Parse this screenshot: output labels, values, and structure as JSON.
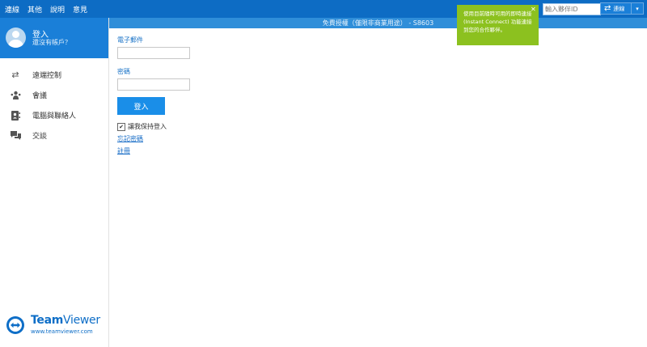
{
  "menu": [
    "連線",
    "其他",
    "說明",
    "意見"
  ],
  "partner": {
    "placeholder": "輸入夥伴ID",
    "connect_label": "連線"
  },
  "license_text": "免費授權（僅限非商業用途） - S8603",
  "account": {
    "title": "登入",
    "subtitle": "還沒有帳戶？"
  },
  "nav": [
    "遠端控制",
    "會議",
    "電腦與聯絡人",
    "交談"
  ],
  "form": {
    "email_label": "電子郵件",
    "password_label": "密碼",
    "login_label": "登入",
    "keep_label": "讓我保持登入",
    "forgot_label": "忘記密碼",
    "register_label": "註冊"
  },
  "tooltip": {
    "text": "使用目前隨時可用的即時連接 (Instant Connect) 功能連接到您的合作夥伴。"
  },
  "logo": {
    "name_bold": "Team",
    "name_light": "Viewer",
    "url": "www.teamviewer.com"
  },
  "colors": {
    "primary": "#0d6cc4",
    "accent": "#1a8ee8",
    "tooltip": "#8cc11f"
  }
}
